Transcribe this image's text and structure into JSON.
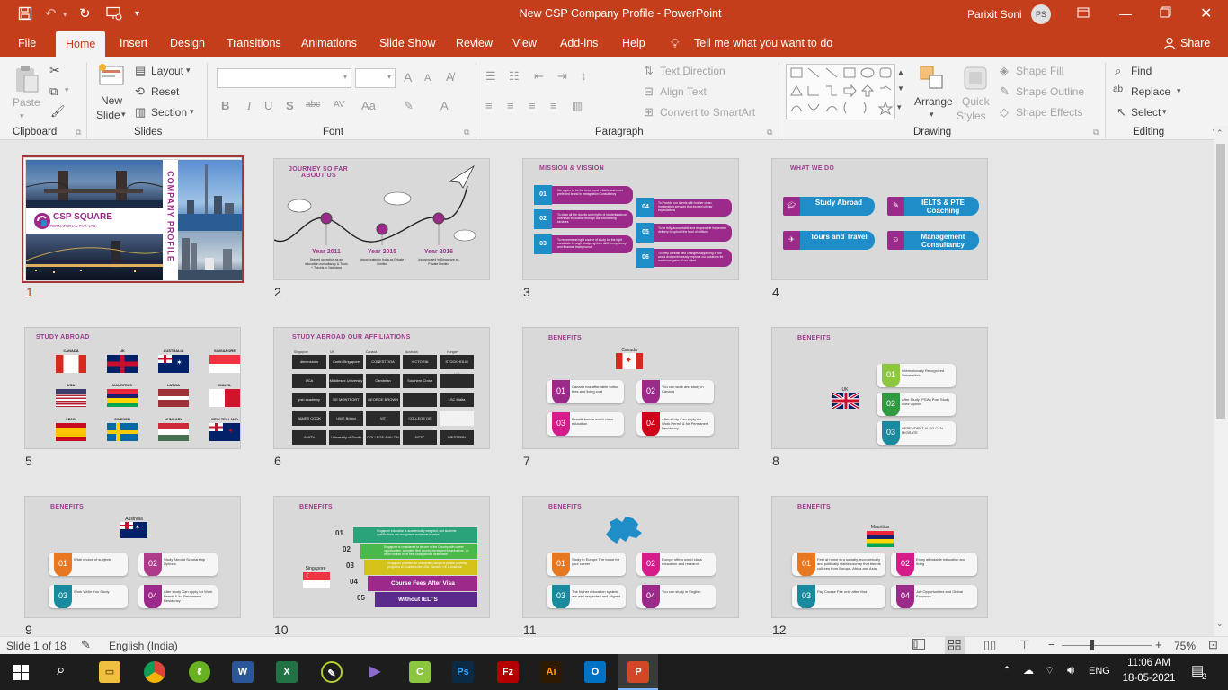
{
  "window": {
    "title": "New CSP Company Profile  -  PowerPoint",
    "user": "Parixit Soni",
    "user_initials": "PS"
  },
  "qat": {
    "save": "save-icon",
    "undo": "undo-icon",
    "redo": "redo-icon",
    "present": "present-icon",
    "more": "▾"
  },
  "tabs": [
    "File",
    "Home",
    "Insert",
    "Design",
    "Transitions",
    "Animations",
    "Slide Show",
    "Review",
    "View",
    "Add-ins",
    "Help"
  ],
  "tell_me": "Tell me what you want to do",
  "share": "Share",
  "ribbon": {
    "clipboard": {
      "name": "Clipboard",
      "paste": "Paste"
    },
    "slides": {
      "name": "Slides",
      "new_slide": "New",
      "new_slide2": "Slide",
      "layout": "Layout",
      "reset": "Reset",
      "section": "Section"
    },
    "font": {
      "name": "Font",
      "bold": "B",
      "italic": "I",
      "underline": "U",
      "shadow": "S",
      "strike": "abc",
      "spacing": "AV",
      "case": "Aa",
      "color": "A",
      "grow": "A",
      "shrink": "A"
    },
    "paragraph": {
      "name": "Paragraph",
      "text_direction": "Text Direction",
      "align_text": "Align Text",
      "smartart": "Convert to SmartArt"
    },
    "drawing": {
      "name": "Drawing",
      "arrange": "Arrange",
      "quick_styles": "Quick",
      "quick_styles2": "Styles",
      "shape_fill": "Shape Fill",
      "shape_outline": "Shape Outline",
      "shape_effects": "Shape Effects"
    },
    "editing": {
      "name": "Editing",
      "find": "Find",
      "replace": "Replace",
      "select": "Select"
    }
  },
  "slides": [
    {
      "num": "1",
      "title": "COMPANY PROFILE",
      "logo": "CSP SQUARE",
      "logo_sub": "INTERNATIONAL PVT. LTD."
    },
    {
      "num": "2",
      "heading": "JOURNEY SO FAR",
      "heading2": "ABOUT US",
      "years": [
        "Year 2011",
        "Year 2015",
        "Year 2016"
      ],
      "notes": [
        "Started operation as an education consultancy & Tours + Travels in Vadodara",
        "Incorporated in India as Private Limited",
        "Incorporated in Singapore as Private Limited"
      ]
    },
    {
      "num": "3",
      "heading": "MISSION & VISSION",
      "items": [
        {
          "n": "01",
          "t": "We aspire to be the best, most reliable and most preferred brand in Immigration Consultancy"
        },
        {
          "n": "02",
          "t": "To clear all the doubts and myths of students about overseas education through our counselling services"
        },
        {
          "n": "03",
          "t": "To recommend right course of study for the right candidate through analyzing their skill, competency and financial background"
        },
        {
          "n": "04",
          "t": "To Provide our clients with kosher clean Immigration services that exceed clients' expectations"
        },
        {
          "n": "05",
          "t": "To be fully accountable and responsible for service delivery to uphold the trust of millions"
        },
        {
          "n": "06",
          "t": "To keep abreast with changes happening in the world and continuously improve our solutions for maximum gains of our client"
        }
      ]
    },
    {
      "num": "4",
      "heading": "WHAT WE DO",
      "services": [
        "Study Abroad",
        "IELTS & PTE Coaching",
        "Tours and Travel",
        "Management Consultancy"
      ]
    },
    {
      "num": "5",
      "heading": "STUDY ABROAD",
      "countries": [
        "CANADA",
        "UK",
        "AUSTRALIA",
        "SINGAPORE",
        "USA",
        "MAURITIUS",
        "LATVIA",
        "MALTA",
        "SPAIN",
        "SWEDEN",
        "HUNGARY",
        "NEW ZEALAND"
      ]
    },
    {
      "num": "6",
      "heading": "STUDY ABROAD OUR AFFILIATIONS",
      "regions": [
        "Singapore",
        "UK",
        "Canada",
        "Australia",
        "Hungary",
        "Malta",
        "Latvia",
        "Paris",
        "USA"
      ],
      "logos": [
        "dimensions",
        "Curtin Singapore",
        "CONESTOGA",
        "VICTORIA UNIVERSITY",
        "STOCKHOLM",
        "UCA",
        "Middlesex University",
        "Cambrian",
        "Southern Cross University",
        "",
        "psb academy",
        "DE MONTFORT UNIVERSITY",
        "GEORGE BROWN",
        "",
        "LSC Malta",
        "JAMES COOK UNIVERSITY",
        "UWE Bristol",
        "VIT",
        "COLLEGE DE PARIS",
        "RTU",
        "AMITY",
        "University of South Wales",
        "COLLEGE AVALON",
        "KETC",
        "WESTERN"
      ]
    },
    {
      "num": "7",
      "heading": "BENEFITS",
      "country": "Canada",
      "items": [
        {
          "n": "01",
          "t": "Canada has affordable tuition fees and living cost"
        },
        {
          "n": "02",
          "t": "You can work and study in Canada"
        },
        {
          "n": "03",
          "t": "Benefit from a world-class education"
        },
        {
          "n": "04",
          "t": "After study Can apply for Work Permit & for Permanent Residency"
        }
      ]
    },
    {
      "num": "8",
      "heading": "BENEFITS",
      "country": "UK",
      "items": [
        {
          "n": "01",
          "t": "Internationally Recognized Universities"
        },
        {
          "n": "02",
          "t": "After Study (PSW) Post Study work Option"
        },
        {
          "n": "03",
          "t": "DEPENDENT ALSO CAN MIGRATE"
        }
      ]
    },
    {
      "num": "9",
      "heading": "BENEFITS",
      "country": "Australia",
      "items": [
        {
          "n": "01",
          "t": "Wide choice of subjects"
        },
        {
          "n": "02",
          "t": "Study Abroad Scholarship Options"
        },
        {
          "n": "03",
          "t": "Work While You Study"
        },
        {
          "n": "04",
          "t": "After study Can apply for Work Permit & for Permanent Residency"
        }
      ]
    },
    {
      "num": "10",
      "heading": "BENEFITS",
      "country": "Singapore",
      "items": [
        {
          "n": "01",
          "t": "Singapore education is academically weighted, and students qualifications are recognised worldwide in value"
        },
        {
          "n": "02",
          "t": "Singapore is considered to be one of the Country with career opportunities, complete flexi country developed infrastructure, on which makes it the best study abroad destination"
        },
        {
          "n": "03",
          "t": "Singapore provides an outstanding scope to pursue pathway programs to Countries like USA, Canada, UK & Australia"
        },
        {
          "n": "04",
          "t": "Course Fees After Visa"
        },
        {
          "n": "05",
          "t": "Without IELTS"
        }
      ]
    },
    {
      "num": "11",
      "heading": "BENEFITS",
      "items": [
        {
          "n": "01",
          "t": "Study in Europe The boost for your career"
        },
        {
          "n": "02",
          "t": "Europe offers world class education and research"
        },
        {
          "n": "03",
          "t": "The higher education system are well respected and aligned"
        },
        {
          "n": "04",
          "t": "You can study in English"
        }
      ]
    },
    {
      "num": "12",
      "heading": "BENEFITS",
      "country": "Mauritius",
      "items": [
        {
          "n": "01",
          "t": "Feel at home in a socially, economically and politically stable country that blends cultures from Europe, Africa and Asia."
        },
        {
          "n": "02",
          "t": "Enjoy affordable education and living"
        },
        {
          "n": "03",
          "t": "Pay Course Fee only after Visa"
        },
        {
          "n": "04",
          "t": "Job Opportunities and Global Exposure"
        }
      ]
    }
  ],
  "status": {
    "slide": "Slide 1 of 18",
    "language": "English (India)",
    "zoom": "75%",
    "zoom_minus": "−",
    "zoom_plus": "+"
  },
  "taskbar": {
    "lang": "ENG",
    "time": "11:06 AM",
    "date": "18-05-2021",
    "notif": "2"
  },
  "colors": {
    "accent": "#c43e1c",
    "purple": "#9b2a8a",
    "blue": "#1e8dc8"
  }
}
